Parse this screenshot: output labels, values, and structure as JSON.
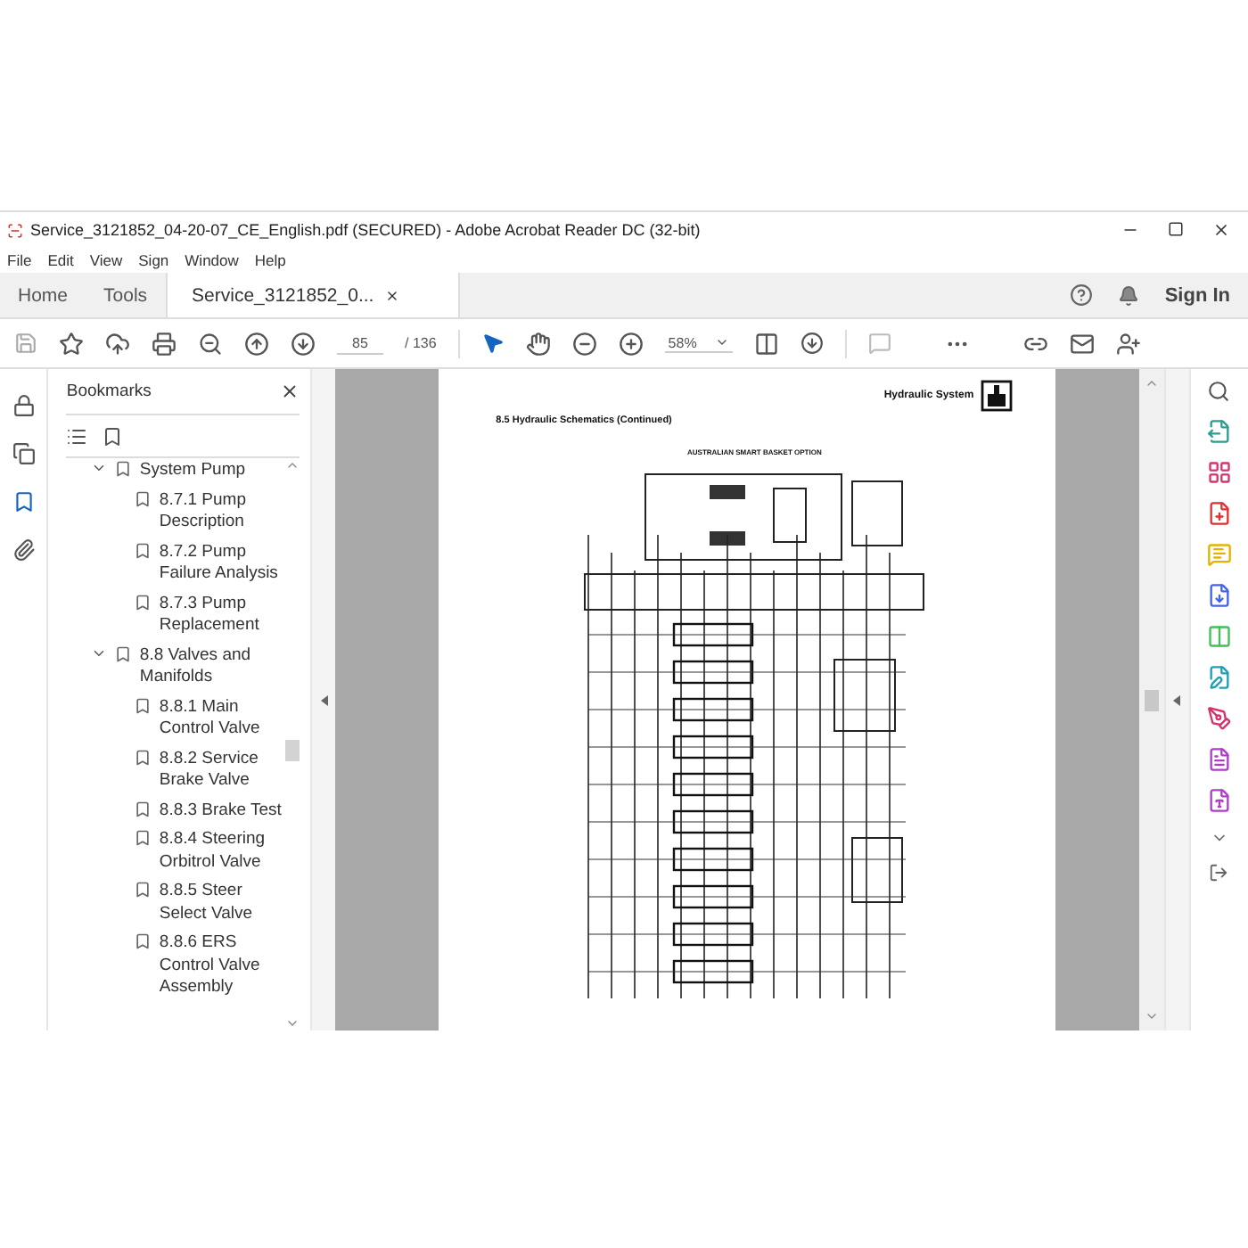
{
  "window": {
    "title": "Service_3121852_04-20-07_CE_English.pdf (SECURED) - Adobe Acrobat Reader DC (32-bit)"
  },
  "menu": [
    "File",
    "Edit",
    "View",
    "Sign",
    "Window",
    "Help"
  ],
  "tabs": [
    {
      "label": "Home",
      "selected": false
    },
    {
      "label": "Tools",
      "selected": false
    },
    {
      "label": "Service_3121852_0...",
      "selected": true
    }
  ],
  "sign_in": "Sign In",
  "toolbar": {
    "page": "85",
    "page_total": "/ 136",
    "zoom": "58%"
  },
  "left_rail": [
    {
      "kind": "lock",
      "selected": false
    },
    {
      "kind": "pages",
      "selected": false
    },
    {
      "kind": "bookmarks",
      "selected": true
    },
    {
      "kind": "attachments",
      "selected": false
    }
  ],
  "bookmarks": {
    "title": "Bookmarks",
    "items": [
      {
        "label": "System Pump",
        "expanded": true,
        "children": [
          {
            "label": "8.7.1 Pump Description"
          },
          {
            "label": "8.7.2 Pump Failure Analysis"
          },
          {
            "label": "8.7.3 Pump Replacement"
          }
        ]
      },
      {
        "label": "8.8 Valves and Manifolds",
        "expanded": true,
        "children": [
          {
            "label": "8.8.1 Main Control Valve"
          },
          {
            "label": "8.8.2 Service Brake Valve"
          },
          {
            "label": "8.8.3 Brake Test"
          },
          {
            "label": "8.8.4 Steering Orbitrol Valve"
          },
          {
            "label": "8.8.5 Steer Select Valve"
          },
          {
            "label": "8.8.6 ERS Control Valve Assembly"
          }
        ]
      }
    ]
  },
  "page": {
    "header": "Hydraulic System",
    "section": "8.5 Hydraulic Schematics (Continued)",
    "figure_caption": "AUSTRALIAN SMART BASKET OPTION"
  },
  "right_tools": [
    {
      "kind": "export",
      "color": "#2a9d8f"
    },
    {
      "kind": "organize",
      "color": "#d6336c"
    },
    {
      "kind": "create",
      "color": "#e03131"
    },
    {
      "kind": "comment",
      "color": "#e8b100"
    },
    {
      "kind": "convert",
      "color": "#4263eb"
    },
    {
      "kind": "compress",
      "color": "#40c057"
    },
    {
      "kind": "edit",
      "color": "#1c9fb5"
    },
    {
      "kind": "sign",
      "color": "#d6336c"
    },
    {
      "kind": "form",
      "color": "#ae3ec9"
    },
    {
      "kind": "protect",
      "color": "#ae3ec9"
    }
  ]
}
